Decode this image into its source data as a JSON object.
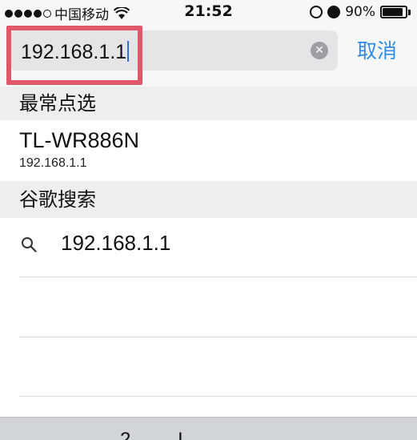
{
  "status_bar": {
    "carrier": "中国移动",
    "time": "21:52",
    "battery_percent": "90%",
    "battery_level": 0.9
  },
  "search": {
    "value": "192.168.1.1",
    "cancel_label": "取消"
  },
  "favorites": {
    "header": "最常点选",
    "items": [
      {
        "title": "TL-WR886N",
        "subtitle": "192.168.1.1"
      }
    ]
  },
  "google_search": {
    "header": "谷歌搜索",
    "suggestions": [
      "192.168.1.1"
    ]
  },
  "keyboard": {
    "partial_keys": [
      "2",
      "I"
    ]
  },
  "colors": {
    "accent_blue": "#2e8ce6",
    "highlight_red": "#e0586a"
  },
  "icons": {
    "clear": "clear-x-icon",
    "suggestion": "search-icon"
  }
}
